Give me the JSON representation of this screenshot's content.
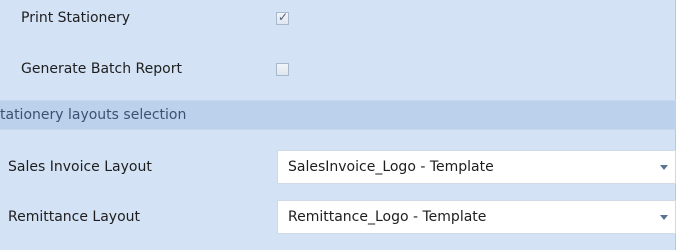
{
  "options": {
    "print_stationery": {
      "label": "Print Stationery",
      "checked": true
    },
    "generate_batch_report": {
      "label": "Generate Batch Report",
      "checked": false
    }
  },
  "stationery_layouts": {
    "section_title": "tationery layouts selection",
    "sales_invoice": {
      "label": "Sales Invoice Layout",
      "value": "SalesInvoice_Logo - Template"
    },
    "remittance": {
      "label": "Remittance Layout",
      "value": "Remittance_Logo - Template"
    }
  },
  "icons": {
    "checkbox_checked": "check-icon",
    "dropdown": "chevron-down-icon"
  },
  "colors": {
    "panel_background": "#d3e2f5",
    "section_header_background": "#bcd1ec",
    "section_title_text": "#3a5272"
  }
}
